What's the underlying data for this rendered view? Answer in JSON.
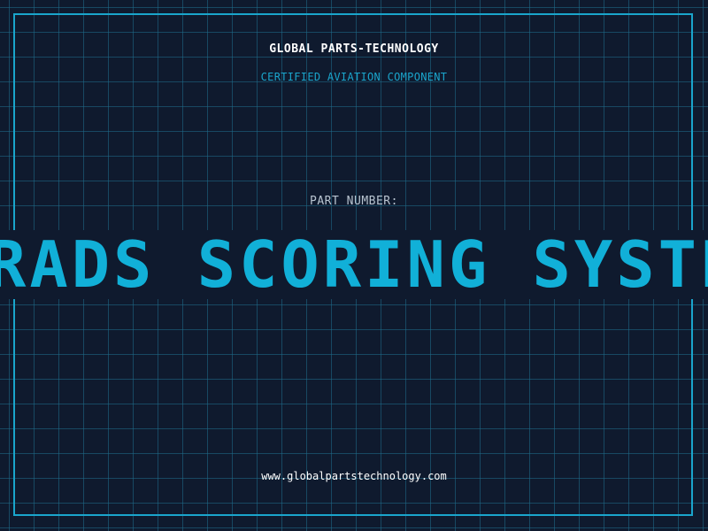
{
  "header": {
    "company_name": "GLOBAL PARTS-TECHNOLOGY",
    "subtitle": "CERTIFIED AVIATION COMPONENT"
  },
  "part": {
    "label": "PART NUMBER:",
    "value": "RADS SCORING SYSTEM"
  },
  "footer": {
    "website": "www.globalpartstechnology.com"
  },
  "colors": {
    "background": "#0f1a2e",
    "grid": "#1e6e8c",
    "accent": "#1aa5cc",
    "part_text": "#11b0d8",
    "heading_text": "#ffffff",
    "label_text": "#b8c4d0"
  }
}
